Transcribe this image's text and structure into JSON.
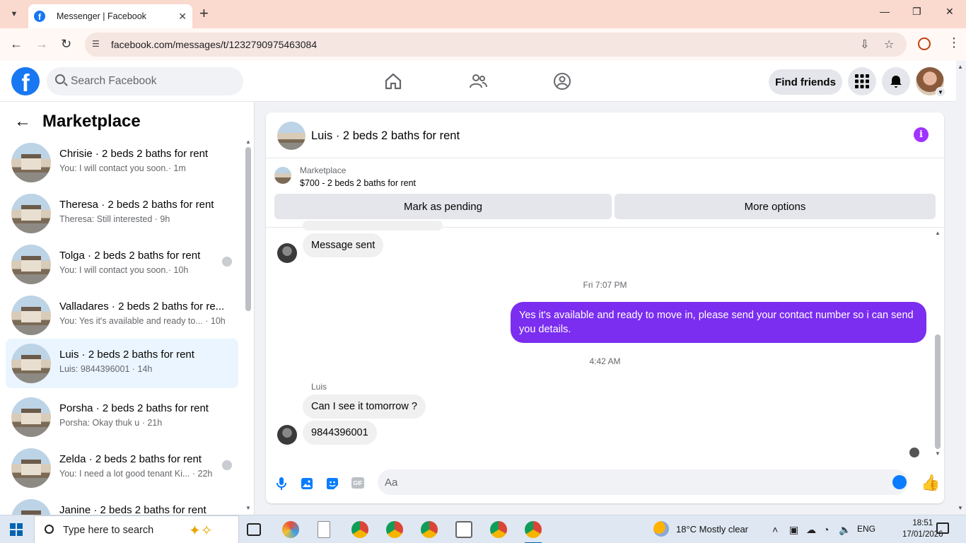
{
  "browser": {
    "tab_title": "Messenger | Facebook",
    "url": "facebook.com/messages/t/1232790975463084"
  },
  "fb": {
    "search_placeholder": "Search Facebook",
    "find_friends": "Find friends"
  },
  "sidebar": {
    "title": "Marketplace",
    "conversations": [
      {
        "name": "Chrisie · 2 beds 2 baths for rent",
        "last": "You: I will contact you soon.· 1m"
      },
      {
        "name": "Theresa · 2 beds 2 baths for rent",
        "last": "Theresa: Still interested · 9h"
      },
      {
        "name": "Tolga · 2 beds 2 baths for rent",
        "last": "You: I will contact you soon.· 10h"
      },
      {
        "name": "Valladares · 2 beds 2 baths for re...",
        "last": "You: Yes it's available and ready to... · 10h"
      },
      {
        "name": "Luis · 2 beds 2 baths for rent",
        "last": "Luis: 9844396001 · 14h"
      },
      {
        "name": "Porsha · 2 beds 2 baths for rent",
        "last": "Porsha: Okay thuk u · 21h"
      },
      {
        "name": "Zelda · 2 beds 2 baths for rent",
        "last": "You: I need a lot good tenant Ki... · 22h"
      },
      {
        "name": "Janine · 2 beds 2 baths for rent",
        "last": ""
      }
    ]
  },
  "chat": {
    "title": "Luis · 2 beds 2 baths for rent",
    "marketplace_label": "Marketplace",
    "listing": "$700 - 2 beds 2 baths for rent",
    "mark_pending": "Mark as pending",
    "more_options": "More options",
    "messages": {
      "msg_sent": "Message sent",
      "time1": "Fri 7:07 PM",
      "outgoing": "Yes it's available and ready to move in, please send your contact number so i can send you details.",
      "time2": "4:42 AM",
      "sender": "Luis",
      "in1": "Can I see it tomorrow ?",
      "in2": "9844396001"
    },
    "composer_placeholder": "Aa",
    "composer_gif": "GIF"
  },
  "taskbar": {
    "search_placeholder": "Type here to search",
    "weather": "18°C  Mostly clear",
    "lang": "ENG",
    "time": "18:51",
    "date": "17/01/2026"
  },
  "colors": {
    "fb_blue": "#1877f2",
    "messenger_purple": "#7b2df0",
    "active_row": "#ebf5ff",
    "tabbar": "#fad9cf"
  }
}
